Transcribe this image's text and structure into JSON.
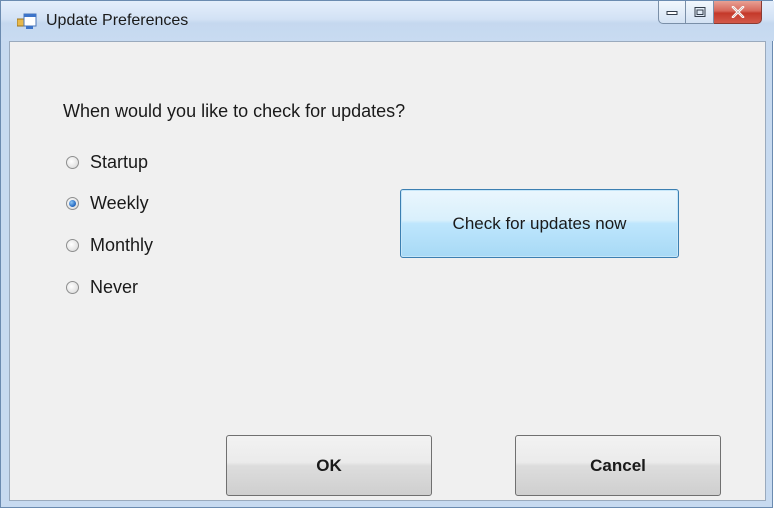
{
  "window": {
    "title": "Update Preferences",
    "icons": {
      "app": "form-icon",
      "minimize": "minimize-icon",
      "maximize": "maximize-icon",
      "close": "close-icon"
    }
  },
  "prompt": "When would you like to check for updates?",
  "options": [
    {
      "label": "Startup",
      "checked": false
    },
    {
      "label": "Weekly",
      "checked": true
    },
    {
      "label": "Monthly",
      "checked": false
    },
    {
      "label": "Never",
      "checked": false
    }
  ],
  "buttons": {
    "check_now": "Check for updates now",
    "ok": "OK",
    "cancel": "Cancel"
  }
}
